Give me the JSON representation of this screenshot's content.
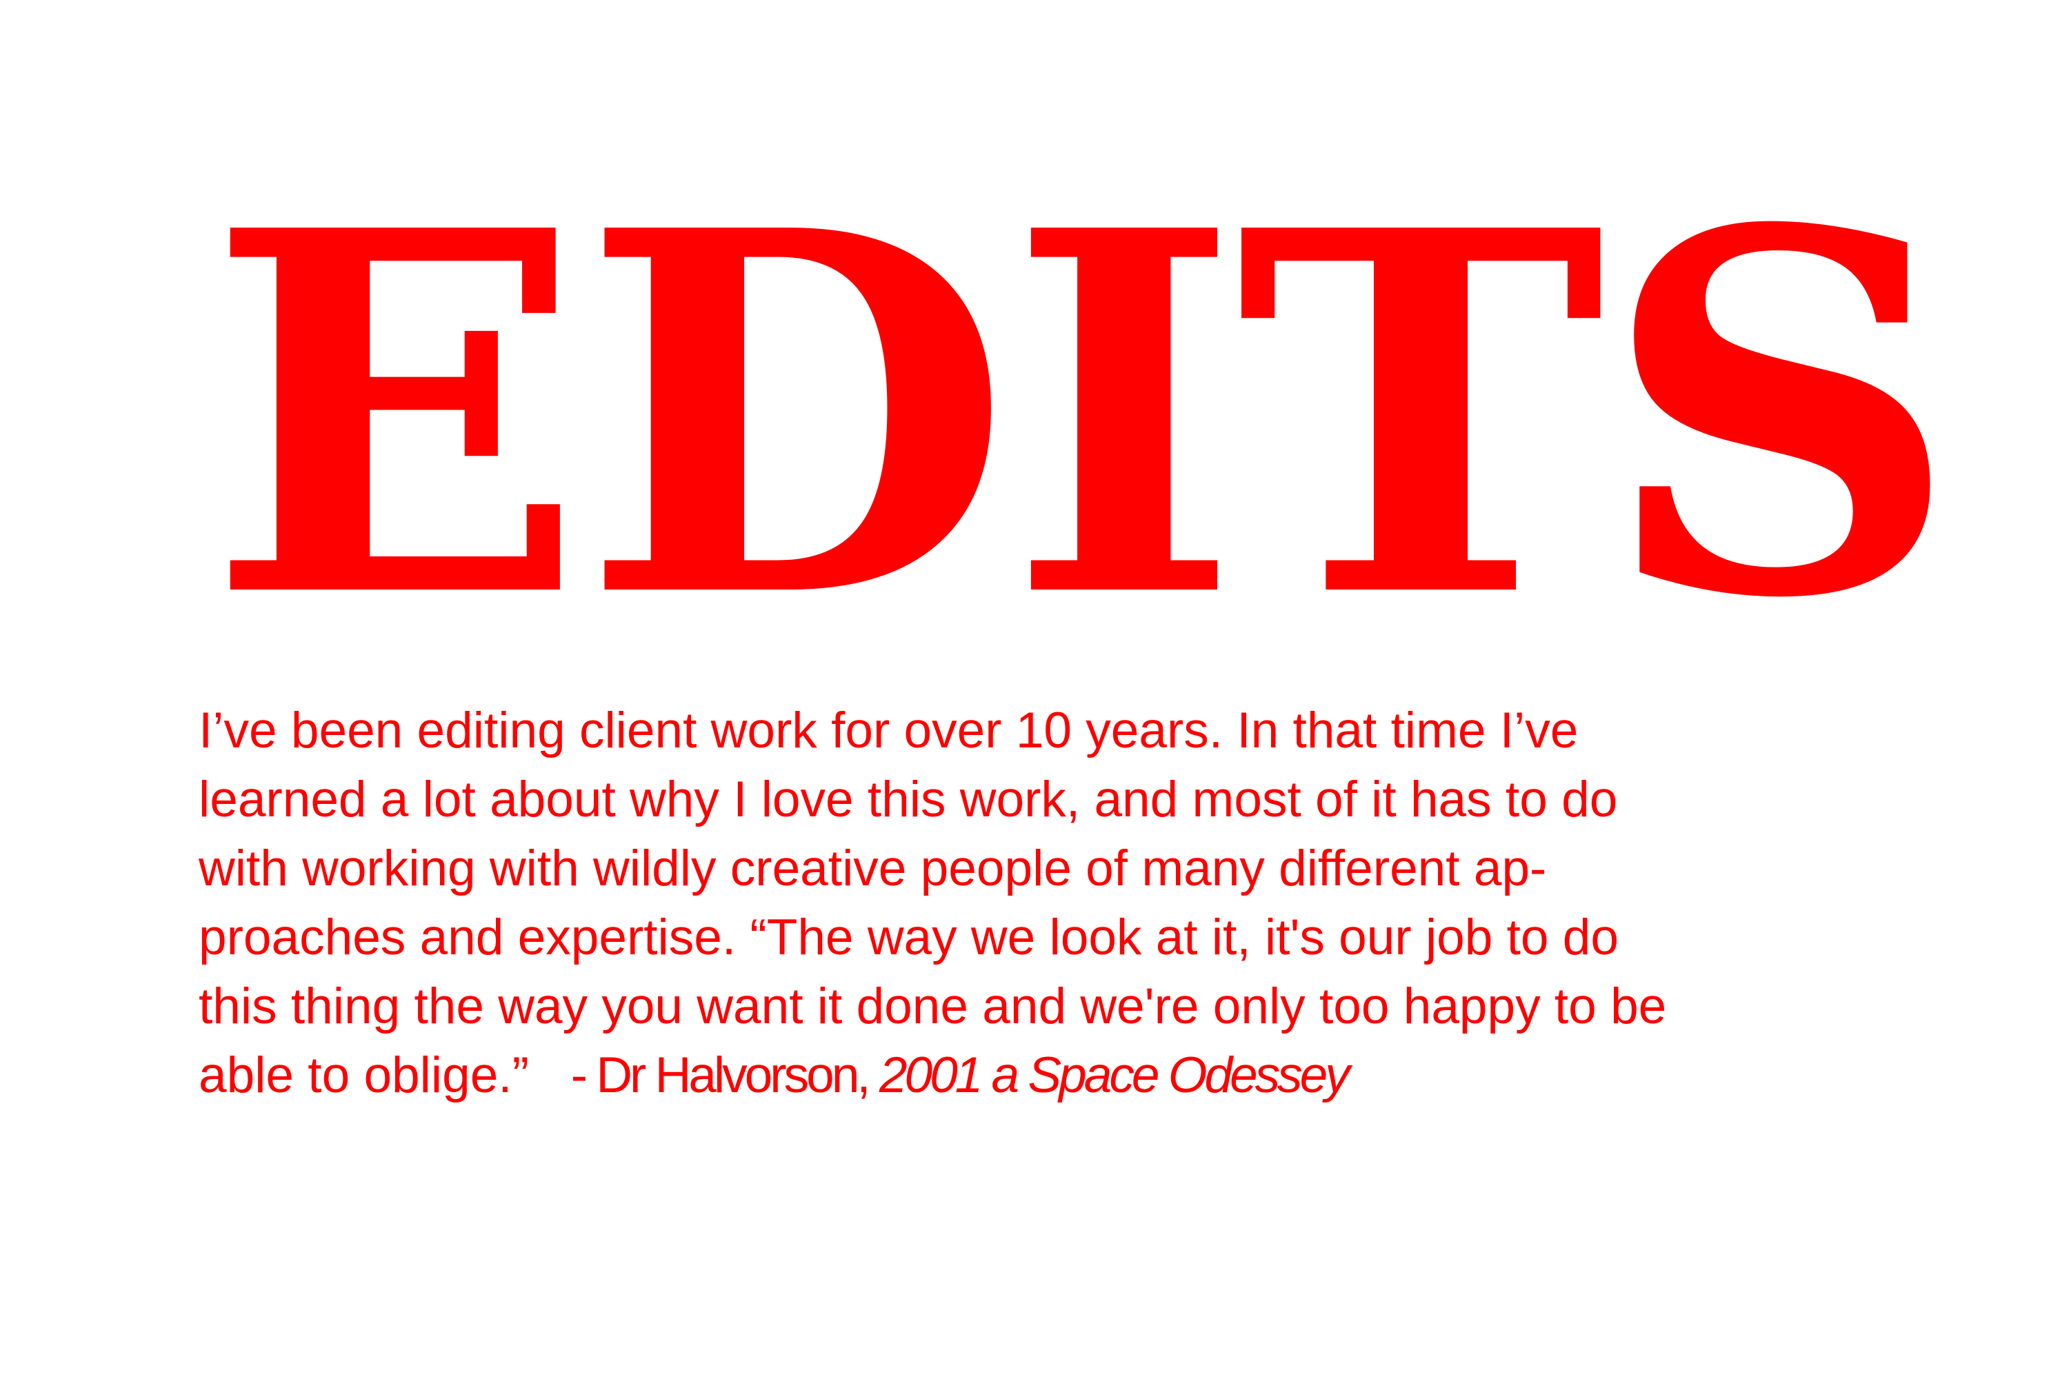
{
  "colors": {
    "accent": "#ff0000",
    "background": "#ffffff"
  },
  "title": "EDITS",
  "body": {
    "lines": [
      "I’ve been editing client work for over 10 years. In that time I’ve",
      "learned a lot about why I love this work, and most of it has to do",
      "with working with wildly creative people of many different ap-",
      "proaches and expertise. “The way we look at it, it's our job to do",
      "this thing the way you want it done and we're only too happy to be",
      "able to oblige.”"
    ],
    "attribution": {
      "speaker": "- Dr Halvorson,",
      "work": "2001 a Space Odessey"
    }
  }
}
